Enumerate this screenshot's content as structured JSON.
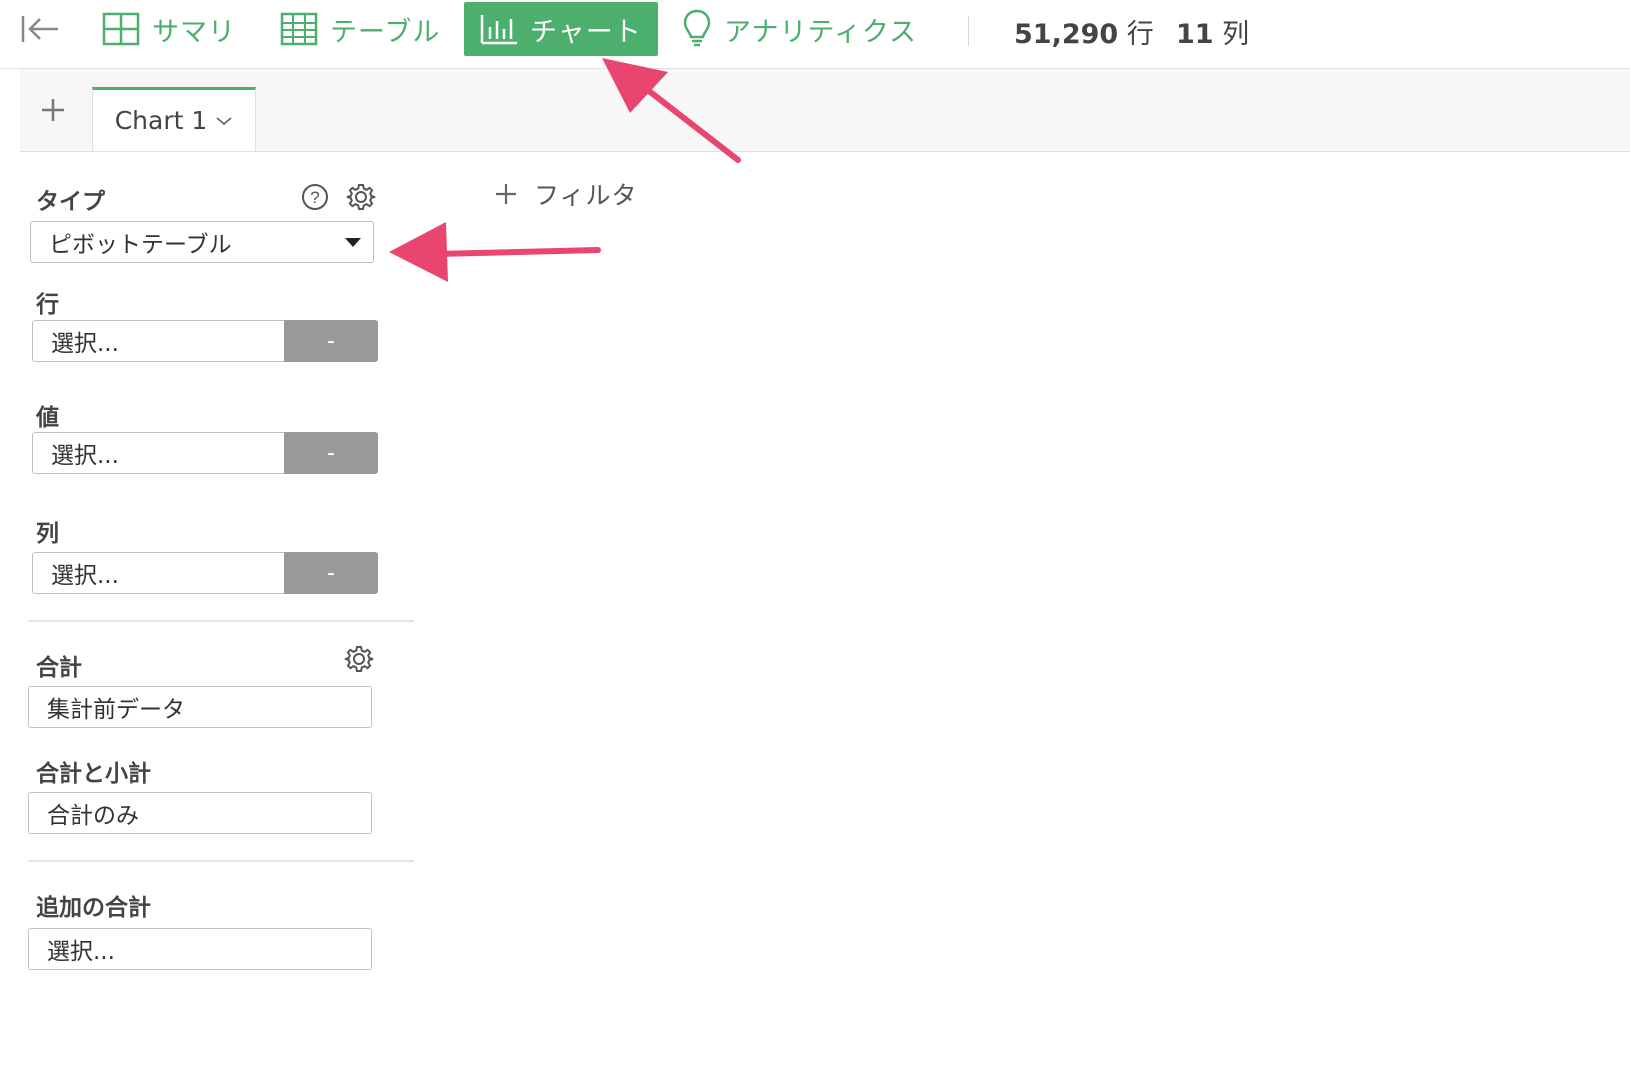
{
  "toolbar": {
    "tabs": [
      {
        "label": "サマリ",
        "icon": "summary-grid-icon",
        "active": false
      },
      {
        "label": "テーブル",
        "icon": "table-icon",
        "active": false
      },
      {
        "label": "チャート",
        "icon": "bar-chart-icon",
        "active": true
      },
      {
        "label": "アナリティクス",
        "icon": "lightbulb-icon",
        "active": false
      }
    ],
    "rows_count": "51,290",
    "rows_unit": "行",
    "cols_count": "11",
    "cols_unit": "列"
  },
  "chart_tabs": {
    "active_label": "Chart 1"
  },
  "panel": {
    "type_label": "タイプ",
    "type_value": "ピボットテーブル",
    "rows_label": "行",
    "rows_placeholder": "選択...",
    "values_label": "値",
    "values_placeholder": "選択...",
    "columns_label": "列",
    "columns_placeholder": "選択...",
    "minus_label": "-",
    "total_label": "合計",
    "total_value": "集計前データ",
    "subtotal_label": "合計と小計",
    "subtotal_value": "合計のみ",
    "extra_total_label": "追加の合計",
    "extra_total_placeholder": "選択..."
  },
  "filter": {
    "label": "フィルタ"
  },
  "colors": {
    "accent": "#4caf6e",
    "annotation": "#e8456f",
    "minus_bg": "#999999"
  }
}
